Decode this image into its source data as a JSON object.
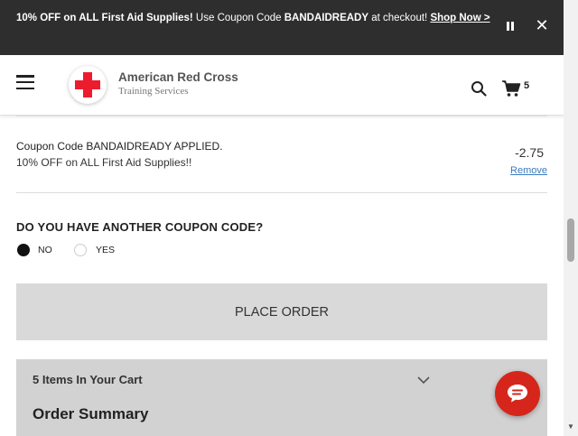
{
  "promo": {
    "bold_text": "10% OFF on ALL First Aid Supplies!",
    "text_part1": " Use Coupon Code ",
    "code": "BANDAIDREADY",
    "text_part2": " at checkout! ",
    "link_label": "Shop Now >"
  },
  "header": {
    "logo_title": "American Red Cross",
    "logo_subtitle": "Training Services",
    "cart_count": "5"
  },
  "coupon": {
    "title": "Coupon Code BANDAIDREADY APPLIED.",
    "description": "10% OFF on ALL First Aid Supplies!!",
    "amount": "-2.75",
    "remove_label": "Remove"
  },
  "another_coupon": {
    "question": "DO YOU HAVE ANOTHER COUPON CODE?",
    "options": [
      "NO",
      "YES"
    ],
    "selected": "NO"
  },
  "place_order_label": "PLACE ORDER",
  "summary": {
    "items_label": "5 Items In Your Cart",
    "title": "Order Summary"
  },
  "colors": {
    "brand_red": "#ed1b2e",
    "banner_bg": "#2e2e2e",
    "link_blue": "#3a7bbf",
    "chat_red": "#d6261c"
  },
  "icons": [
    "pause-icon",
    "close-icon",
    "hamburger-icon",
    "red-cross-logo",
    "search-icon",
    "cart-icon",
    "chevron-down-icon",
    "chat-icon"
  ]
}
